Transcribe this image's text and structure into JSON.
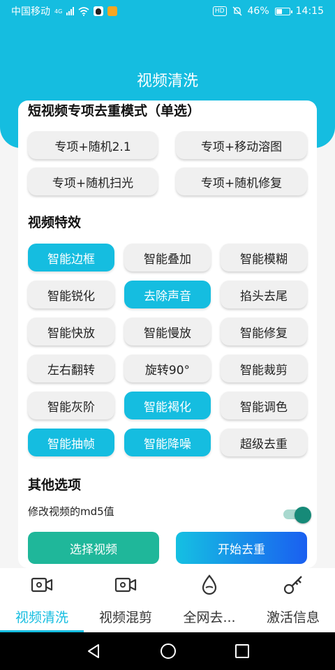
{
  "status": {
    "carrier": "中国移动",
    "network": "4G",
    "battery": "46%",
    "battery_level": 0.46,
    "time": "14:15",
    "hd": "HD"
  },
  "header": {
    "title": "视频清洗"
  },
  "mode_section": {
    "title": "短视频专项去重模式（单选）",
    "options": [
      "专项+随机2.1",
      "专项+移动溶图",
      "专项+随机扫光",
      "专项+随机修复"
    ]
  },
  "effects_section": {
    "title": "视频特效",
    "buttons": [
      {
        "label": "智能边框",
        "active": true
      },
      {
        "label": "智能叠加",
        "active": false
      },
      {
        "label": "智能模糊",
        "active": false
      },
      {
        "label": "智能锐化",
        "active": false
      },
      {
        "label": "去除声音",
        "active": true
      },
      {
        "label": "掐头去尾",
        "active": false
      },
      {
        "label": "智能快放",
        "active": false
      },
      {
        "label": "智能慢放",
        "active": false
      },
      {
        "label": "智能修复",
        "active": false
      },
      {
        "label": "左右翻转",
        "active": false
      },
      {
        "label": "旋转90°",
        "active": false
      },
      {
        "label": "智能裁剪",
        "active": false
      },
      {
        "label": "智能灰阶",
        "active": false
      },
      {
        "label": "智能褐化",
        "active": true
      },
      {
        "label": "智能调色",
        "active": false
      },
      {
        "label": "智能抽帧",
        "active": true
      },
      {
        "label": "智能降噪",
        "active": true
      },
      {
        "label": "超级去重",
        "active": false
      }
    ]
  },
  "other_section": {
    "title": "其他选项",
    "md5_label": "修改视频的md5值",
    "md5_enabled": true
  },
  "actions": {
    "select_video": "选择视频",
    "start": "开始去重"
  },
  "tabs": [
    {
      "label": "视频清洗",
      "icon": "video-camera-icon",
      "active": true
    },
    {
      "label": "视频混剪",
      "icon": "video-camera-icon",
      "active": false
    },
    {
      "label": "全网去...",
      "icon": "drop-icon",
      "active": false
    },
    {
      "label": "激活信息",
      "icon": "key-icon",
      "active": false
    }
  ],
  "colors": {
    "primary": "#15bde0",
    "green": "#1fb79a",
    "toggle": "#168a78"
  }
}
